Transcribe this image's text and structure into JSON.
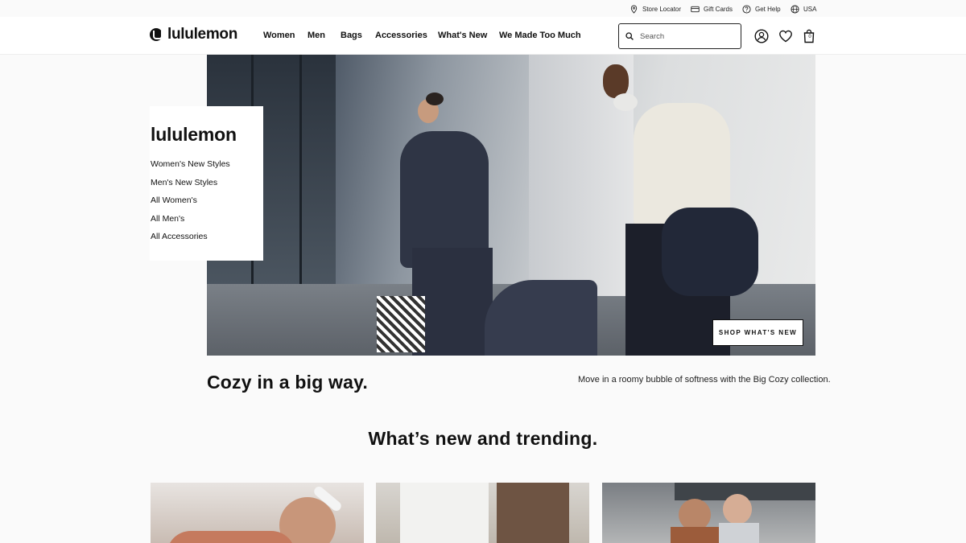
{
  "utility": {
    "store_locator": "Store Locator",
    "gift_cards": "Gift Cards",
    "get_help": "Get Help",
    "region": "USA"
  },
  "header": {
    "logo": "lululemon",
    "nav": [
      "Women",
      "Men",
      "Bags",
      "Accessories",
      "What's New",
      "We Made Too Much"
    ],
    "search_placeholder": "Search",
    "bag_count": "0"
  },
  "hero": {
    "panel_title": "lululemon",
    "links": [
      "Women's New Styles",
      "Men's New Styles",
      "All Women's",
      "All Men's",
      "All Accessories"
    ],
    "cta": "SHOP WHAT'S NEW",
    "headline": "Cozy in a big way.",
    "description": "Move in a roomy bubble of softness with the Big Cozy collection."
  },
  "trending": {
    "title": "What’s new and trending."
  },
  "icons": [
    "pin-icon",
    "gift-card-icon",
    "help-icon",
    "globe-icon",
    "search-icon",
    "account-icon",
    "heart-icon",
    "bag-icon"
  ]
}
